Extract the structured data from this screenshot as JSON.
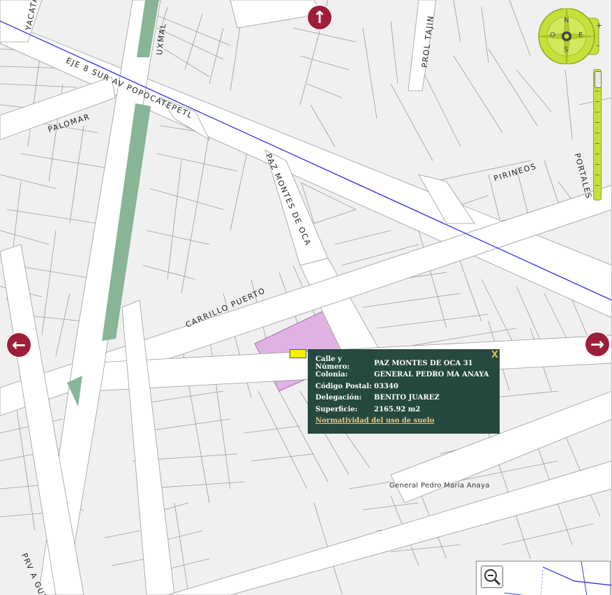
{
  "map": {
    "streets": [
      {
        "id": "yacata",
        "label": "YACATA"
      },
      {
        "id": "uxmal",
        "label": "UXMAL"
      },
      {
        "id": "eje8",
        "label": "EJE 8 SUR AV POPOCATEPETL"
      },
      {
        "id": "palomar",
        "label": "PALOMAR"
      },
      {
        "id": "prol-tajin",
        "label": "PROL TAJIN"
      },
      {
        "id": "paz-montes",
        "label": "PAZ MONTES DE OCA"
      },
      {
        "id": "pirineos",
        "label": "PIRINEOS"
      },
      {
        "id": "portales",
        "label": "PORTALES"
      },
      {
        "id": "carrillo",
        "label": "CARRILLO PUERTO"
      },
      {
        "id": "prv-agu",
        "label": "PRV A GUT"
      }
    ],
    "colonia_label": "General Pedro Maria Anaya",
    "compass": {
      "n": "N",
      "s": "S",
      "e": "E",
      "o": "O",
      "zoom_in": "+",
      "zoom_out": "-"
    },
    "nav": {
      "up": "↑",
      "left": "←",
      "right": "→"
    },
    "colors": {
      "parcel": "#e0b2e4",
      "popup": "#153c31",
      "compass": "#c6df3b",
      "arrow": "#9e1e3a",
      "median": "#87b596",
      "eje_line": "#1a1aee"
    }
  },
  "popup": {
    "close": "X",
    "rows": [
      {
        "label": "Calle y Número:",
        "value": "PAZ MONTES DE OCA 31"
      },
      {
        "label": "Colonia:",
        "value": "GENERAL PEDRO MA ANAYA"
      },
      {
        "label": "Código Postal:",
        "value": "03340"
      },
      {
        "label": "Delegación:",
        "value": "BENITO JUAREZ"
      },
      {
        "label": "Superficie:",
        "value": "2165.92 m2"
      }
    ],
    "link": "Normatividad del uso de suelo"
  }
}
